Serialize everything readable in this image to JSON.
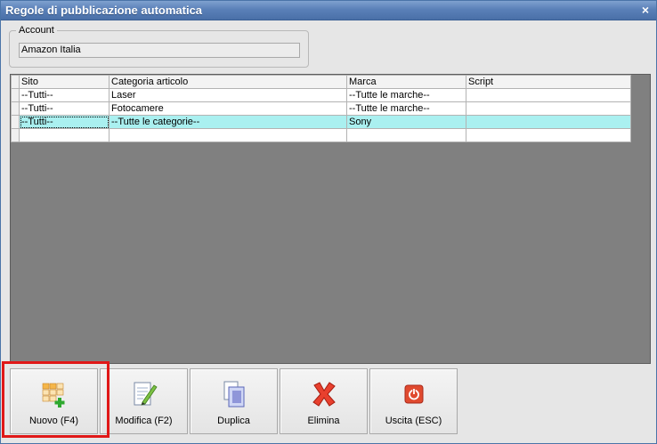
{
  "window": {
    "title": "Regole di pubblicazione automatica",
    "close_glyph": "×"
  },
  "account": {
    "legend": "Account",
    "value": "Amazon Italia"
  },
  "grid": {
    "columns": [
      "Sito",
      "Categoria articolo",
      "Marca",
      "Script"
    ],
    "rows": [
      [
        "--Tutti--",
        "Laser",
        "--Tutte le marche--",
        ""
      ],
      [
        "--Tutti--",
        "Fotocamere",
        "--Tutte le marche--",
        ""
      ],
      [
        "--Tutti--",
        "--Tutte le categorie--",
        "Sony",
        ""
      ],
      [
        "",
        "",
        "",
        ""
      ]
    ],
    "selected_row_color": "#aaf0f0"
  },
  "toolbar": {
    "buttons": [
      {
        "label": "Nuovo (F4)",
        "icon": "new-grid-plus-icon"
      },
      {
        "label": "Modifica (F2)",
        "icon": "edit-document-pencil-icon"
      },
      {
        "label": "Duplica",
        "icon": "duplicate-documents-icon"
      },
      {
        "label": "Elimina",
        "icon": "delete-x-icon"
      },
      {
        "label": "Uscita (ESC)",
        "icon": "exit-power-icon"
      }
    ]
  },
  "colors": {
    "highlight": "#e01818",
    "titlebar": "#5a80b8",
    "grid_bg": "#808080"
  }
}
